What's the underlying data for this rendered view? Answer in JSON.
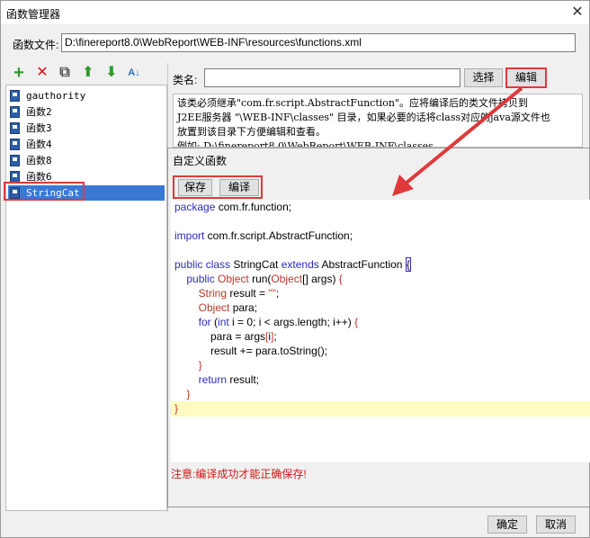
{
  "window": {
    "title": "函数管理器",
    "close_icon": "close-icon"
  },
  "file_label": "函数文件:",
  "file_path": "D:\\finereport8.0\\WebReport\\WEB-INF\\resources\\functions.xml",
  "toolbar": {
    "icons": [
      "add-icon",
      "delete-icon",
      "copy-icon",
      "move-up-icon",
      "move-down-icon",
      "sort-az-icon"
    ],
    "add": "+",
    "delete": "✕",
    "copy": "⧉",
    "up": "⬆",
    "down": "⬇",
    "sort": "A↓"
  },
  "function_list": [
    {
      "name": "gauthority"
    },
    {
      "name": "函数2"
    },
    {
      "name": "函数3"
    },
    {
      "name": "函数4"
    },
    {
      "name": "函数8"
    },
    {
      "name": "函数6"
    },
    {
      "name": "StringCat",
      "selected": true
    }
  ],
  "class_label": "类名:",
  "class_value": "",
  "select_button": "选择",
  "edit_button": "编辑",
  "description": [
    "该类必须继承\"com.fr.script.AbstractFunction\"。应将编译后的类文件拷贝到",
    "J2EE服务器 \"\\WEB-INF\\classes\" 目录，如果必要的话将class对应的java源文件也",
    "放置到该目录下方便编辑和查看。",
    "例如: D:\\finereport8.0\\WebReport\\WEB-INF\\classes"
  ],
  "dialog": {
    "title": "自定义函数",
    "save_button": "保存",
    "compile_button": "编译",
    "warning": "注意:编译成功才能正确保存!"
  },
  "code_lines": [
    "package com.fr.function;",
    "",
    "import com.fr.script.AbstractFunction;",
    "",
    "public class StringCat extends AbstractFunction {",
    "    public Object run(Object[] args) {",
    "        String result = \"\";",
    "        Object para;",
    "        for (int i = 0; i < args.length; i++) {",
    "            para = args[i];",
    "            result += para.toString();",
    "        }",
    "        return result;",
    "    }",
    "}"
  ],
  "ok_button": "确定",
  "cancel_button": "取消",
  "colors": {
    "highlight": "#e0393b",
    "selection": "#3a78d6",
    "arrow": "#e0393b"
  }
}
